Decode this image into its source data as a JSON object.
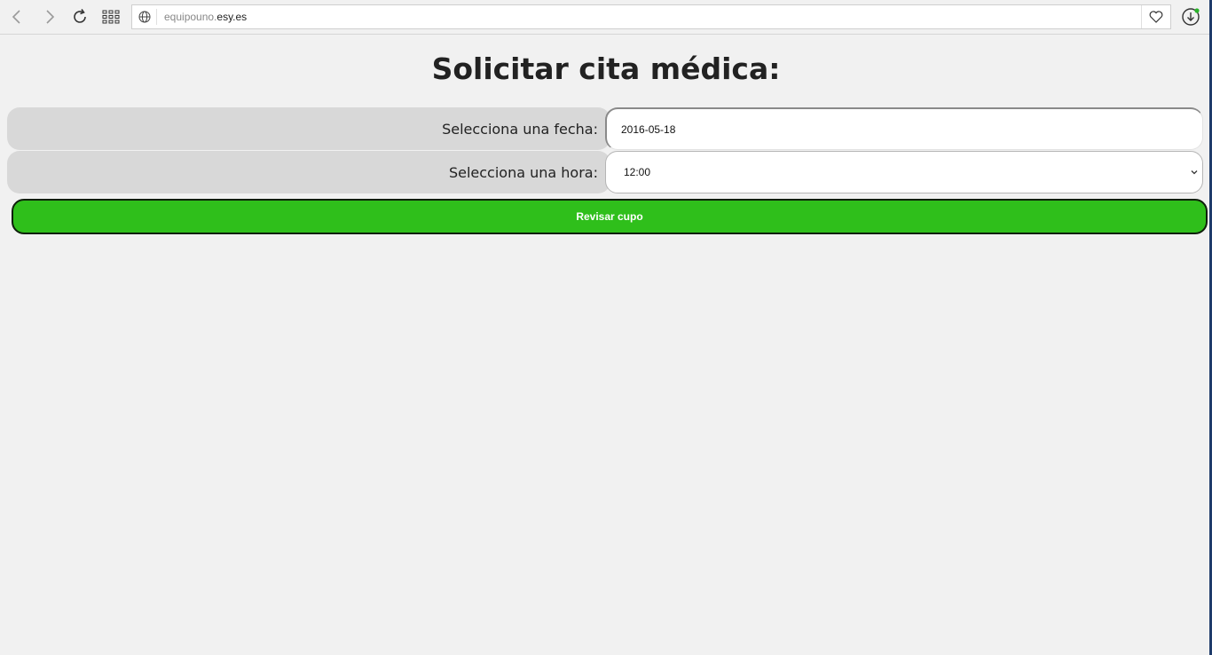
{
  "browser": {
    "url_prefix": "equipouno.",
    "url_domain": "esy.es",
    "icons": [
      "back-icon",
      "forward-icon",
      "reload-icon",
      "apps-grid-icon",
      "globe-icon",
      "heart-icon",
      "download-icon"
    ]
  },
  "page": {
    "title": "Solicitar cita médica:",
    "date_label": "Selecciona una fecha:",
    "date_value": "2016-05-18",
    "time_label": "Selecciona una hora:",
    "time_value": "12:00",
    "submit_label": "Revisar cupo"
  },
  "colors": {
    "background": "#f1f1f1",
    "label_cell": "#d8d8d8",
    "submit_green": "#2fbf1b"
  }
}
